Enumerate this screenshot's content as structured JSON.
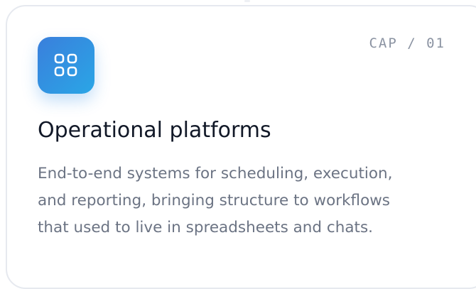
{
  "card": {
    "icon": "grid-icon",
    "accent_gradient": [
      "#3a7fdc",
      "#2aa6e6"
    ],
    "cap_label": "CAP / 01",
    "title": "Operational platforms",
    "description_lines": [
      "End-to-end systems for scheduling, execution,",
      "and reporting, bringing structure to workflows",
      "that used to live in spreadsheets and chats."
    ]
  }
}
